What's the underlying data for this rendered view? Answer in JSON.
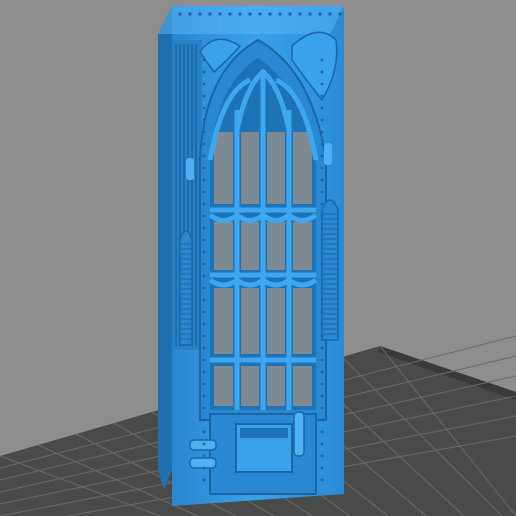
{
  "scene": {
    "background_color": "#8e8e8e",
    "grid_color": "#5a5a5a",
    "build_plate_color": "#3c3c3c",
    "model_color": "#2f98e6",
    "model_shadow_color": "#1f6fae",
    "model_highlight_color": "#5ab4f2",
    "model_description_icon": "gothic-window-wall-panel-3d-model"
  }
}
